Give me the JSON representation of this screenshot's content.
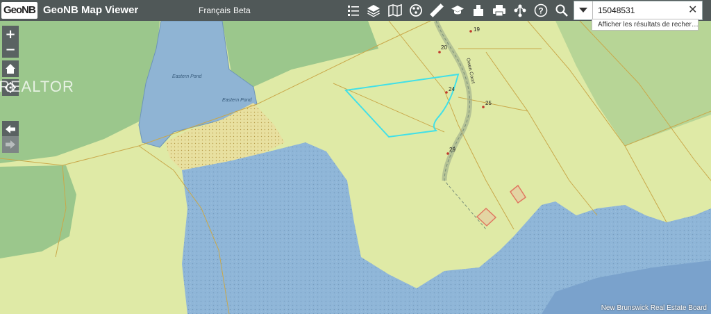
{
  "header": {
    "logo_text": "GeoNB",
    "title": "GeoNB Map Viewer",
    "lang_link": "Français",
    "beta_link": "Beta"
  },
  "toolbar": {
    "icons": [
      "list-icon",
      "layers-icon",
      "basemap-icon",
      "map-themes-icon",
      "measure-icon",
      "education-icon",
      "bookmark-icon",
      "print-icon",
      "share-icon",
      "help-icon"
    ]
  },
  "search": {
    "value": "15048531",
    "suggestion": "Afficher les résultats de recher…"
  },
  "map": {
    "water_labels": [
      "Eastern Pond",
      "Eastern Pond"
    ],
    "lot_labels": [
      "19",
      "20",
      "24",
      "25",
      "29"
    ],
    "road_label": "Owen Court",
    "colors": {
      "land": "#dfeaa6",
      "forest": "#9bc78c",
      "water": "#8fb4d4",
      "sea": "#8fb6d8",
      "selection": "#40e0e8",
      "parcel_line": "#c9a84a",
      "building": "#e07860"
    }
  },
  "watermark": "REALTOR",
  "credit": "New Brunswick Real Estate Board"
}
